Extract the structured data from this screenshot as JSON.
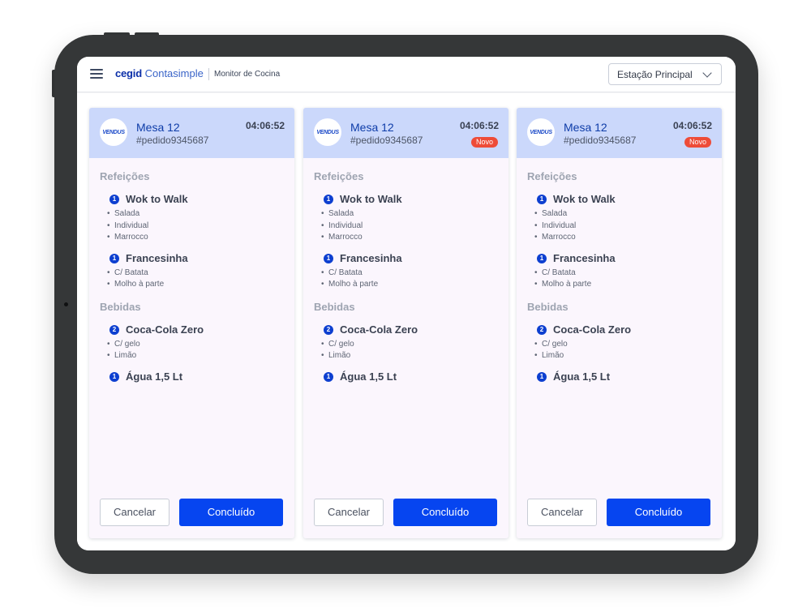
{
  "header": {
    "brand": "cegid",
    "product": "Contasimple",
    "module": "Monitor de Cocina",
    "station": "Estação Principal"
  },
  "colors": {
    "primary": "#0645f0",
    "header_bg": "#cbd8fb",
    "card_bg": "#fbf6fd",
    "badge": "#ee4c38"
  },
  "orders": [
    {
      "logo": "VENDUS",
      "table": "Mesa 12",
      "order_id": "#pedido9345687",
      "time": "04:06:52",
      "badge": "",
      "sections": [
        {
          "title": "Refeições",
          "items": [
            {
              "qty": "1",
              "name": "Wok to Walk",
              "mods": [
                "Salada",
                "Individual",
                "Marrocco"
              ]
            },
            {
              "qty": "1",
              "name": "Francesinha",
              "mods": [
                "C/ Batata",
                "Molho à parte"
              ]
            }
          ]
        },
        {
          "title": "Bebidas",
          "items": [
            {
              "qty": "2",
              "name": "Coca-Cola Zero",
              "mods": [
                "C/ gelo",
                "Limão"
              ]
            },
            {
              "qty": "1",
              "name": "Água 1,5 Lt",
              "mods": []
            }
          ]
        }
      ],
      "cancel_label": "Cancelar",
      "done_label": "Concluído"
    },
    {
      "logo": "VENDUS",
      "table": "Mesa 12",
      "order_id": "#pedido9345687",
      "time": "04:06:52",
      "badge": "Novo",
      "sections": [
        {
          "title": "Refeições",
          "items": [
            {
              "qty": "1",
              "name": "Wok to Walk",
              "mods": [
                "Salada",
                "Individual",
                "Marrocco"
              ]
            },
            {
              "qty": "1",
              "name": "Francesinha",
              "mods": [
                "C/ Batata",
                "Molho à parte"
              ]
            }
          ]
        },
        {
          "title": "Bebidas",
          "items": [
            {
              "qty": "2",
              "name": "Coca-Cola Zero",
              "mods": [
                "C/ gelo",
                "Limão"
              ]
            },
            {
              "qty": "1",
              "name": "Água 1,5 Lt",
              "mods": []
            }
          ]
        }
      ],
      "cancel_label": "Cancelar",
      "done_label": "Concluído"
    },
    {
      "logo": "VENDUS",
      "table": "Mesa 12",
      "order_id": "#pedido9345687",
      "time": "04:06:52",
      "badge": "Novo",
      "sections": [
        {
          "title": "Refeições",
          "items": [
            {
              "qty": "1",
              "name": "Wok to Walk",
              "mods": [
                "Salada",
                "Individual",
                "Marrocco"
              ]
            },
            {
              "qty": "1",
              "name": "Francesinha",
              "mods": [
                "C/ Batata",
                "Molho à parte"
              ]
            }
          ]
        },
        {
          "title": "Bebidas",
          "items": [
            {
              "qty": "2",
              "name": "Coca-Cola Zero",
              "mods": [
                "C/ gelo",
                "Limão"
              ]
            },
            {
              "qty": "1",
              "name": "Água 1,5 Lt",
              "mods": []
            }
          ]
        }
      ],
      "cancel_label": "Cancelar",
      "done_label": "Concluído"
    }
  ]
}
